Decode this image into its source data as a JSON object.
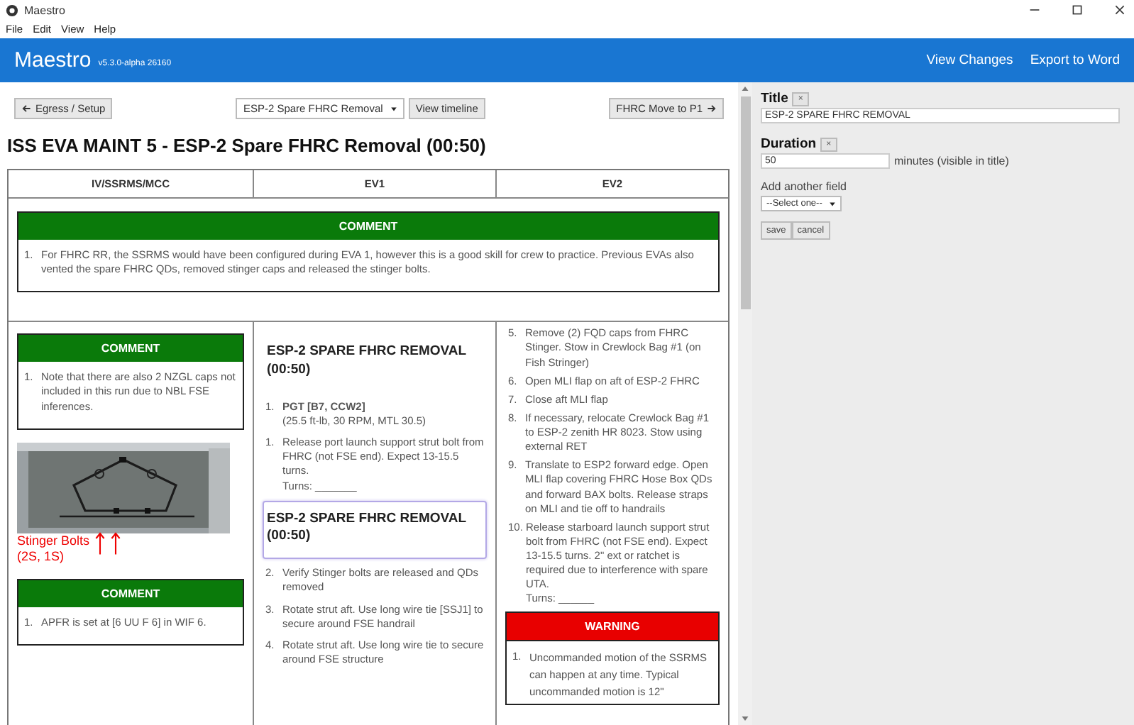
{
  "window": {
    "title": "Maestro"
  },
  "menu": [
    "File",
    "Edit",
    "View",
    "Help"
  ],
  "header": {
    "brand": "Maestro",
    "version": "v5.3.0-alpha 26160",
    "links": [
      "View Changes",
      "Export to Word"
    ]
  },
  "toolbar": {
    "back": "Egress / Setup",
    "activity": "ESP-2 Spare FHRC Removal",
    "timeline": "View timeline",
    "next": "FHRC Move to P1"
  },
  "procedure_title": "ISS EVA MAINT 5 - ESP-2 Spare FHRC Removal (00:50)",
  "table": {
    "columns": [
      "IV/SSRMS/MCC",
      "EV1",
      "EV2"
    ],
    "comment": {
      "title": "COMMENT",
      "items": [
        {
          "number": "1.",
          "text": "For FHRC RR, the SSRMS would have been configured during EVA 1, however this is a good skill for crew to practice. Previous EVAs also vented the spare FHRC QDs, removed stinger caps and released the stinger bolts."
        }
      ]
    },
    "cells": [
      [
        {
          "kind": "comment",
          "title": "COMMENT",
          "items": [
            {
              "number": "1.",
              "text": "Note that there are also 2 NZGL caps not included in this run due to NBL FSE inferences."
            }
          ]
        },
        {
          "caption": "Stinger Bolts\n(2S, 1S)"
        },
        {
          "kind": "comment",
          "title": "COMMENT",
          "items": [
            {
              "number": "1.",
              "text": "APFR is set at [6 UU F 6] in WIF 6."
            }
          ]
        }
      ],
      [
        {
          "kind": "heading",
          "text": "ESP-2 SPARE FHRC REMOVAL (00:50)",
          "selected": false
        },
        {
          "kind": "step",
          "number": "1.",
          "lines": [
            "**PGT [B7, CCW2]**",
            "(25.5 ft-lb, 30 RPM, MTL 30.5)"
          ]
        },
        {
          "kind": "step",
          "number": "1.",
          "lines": [
            "Release port launch support strut bolt from FHRC (not FSE end). Expect 13-15.5 turns.",
            "Turns: _______"
          ]
        },
        {
          "kind": "heading",
          "text": "ESP-2 SPARE FHRC REMOVAL (00:50)",
          "selected": true
        },
        {
          "kind": "step",
          "number": "2.",
          "lines": [
            "Verify Stinger bolts are released and QDs removed"
          ]
        },
        {
          "kind": "step",
          "number": "3.",
          "lines": [
            "Rotate strut aft. Use long wire tie [SSJ1] to secure around FSE handrail"
          ]
        },
        {
          "kind": "step",
          "number": "4.",
          "lines": [
            "Rotate strut aft. Use long wire tie to secure around FSE structure"
          ]
        }
      ],
      [
        {
          "kind": "step",
          "number": "5.",
          "lines": [
            "Remove (2) FQD caps from FHRC Stinger. Stow in Crewlock Bag #1 (on Fish Stringer)"
          ]
        },
        {
          "kind": "step",
          "number": "6.",
          "lines": [
            "Open MLI flap on aft of ESP-2 FHRC"
          ]
        },
        {
          "kind": "step",
          "number": "7.",
          "lines": [
            "Close aft MLI flap"
          ]
        },
        {
          "kind": "step",
          "number": "8.",
          "lines": [
            "If necessary, relocate Crewlock Bag #1 to ESP-2 zenith HR 8023. Stow using external RET"
          ]
        },
        {
          "kind": "step",
          "number": "9.",
          "lines": [
            "Translate to ESP2 forward edge. Open MLI flap covering FHRC Hose Box QDs and forward BAX bolts. Release straps on MLI and tie off to handrails"
          ]
        },
        {
          "kind": "step",
          "number": "10.",
          "lines": [
            "Release starboard launch support strut bolt from FHRC (not FSE end). Expect 13-15.5 turns. 2\" ext or ratchet is required due to interference with spare UTA.",
            "Turns: ______"
          ]
        },
        {
          "kind": "warning",
          "title": "WARNING",
          "items": [
            {
              "number": "1.",
              "text": "Uncommanded motion of the SSRMS can happen at any time. Typical uncommanded motion is 12\""
            }
          ]
        }
      ]
    ]
  },
  "editor": {
    "title_label": "Title",
    "title_value": "ESP-2 SPARE FHRC REMOVAL",
    "remove": "×",
    "duration_label": "Duration",
    "duration_value": "50",
    "duration_hint": "minutes (visible in title)",
    "add_label": "Add another field",
    "add_select": "--Select one--",
    "save": "save",
    "cancel": "cancel"
  }
}
